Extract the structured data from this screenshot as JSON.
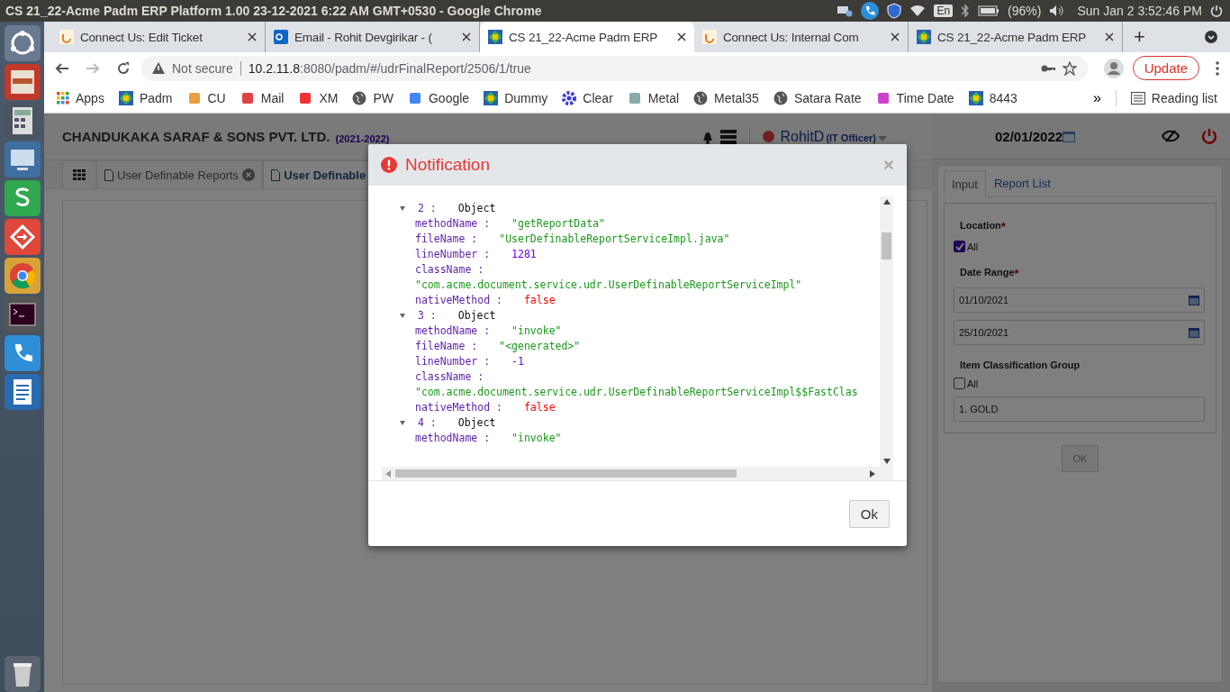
{
  "os_bar": {
    "title": "CS 21_22-Acme Padm ERP Platform 1.00 23-12-2021 6:22 AM GMT+0530 - Google Chrome",
    "keyboard": "En",
    "battery": "(96%)",
    "clock": "Sun Jan 2  3:52:46 PM"
  },
  "browser": {
    "tabs": [
      {
        "title": "Connect Us: Edit Ticket",
        "selected": false
      },
      {
        "title": "Email - Rohit Devgirikar - (",
        "selected": false
      },
      {
        "title": "CS 21_22-Acme Padm ERP",
        "selected": true
      },
      {
        "title": "Connect Us: Internal Com",
        "selected": false
      },
      {
        "title": "CS 21_22-Acme Padm ERP",
        "selected": false
      }
    ],
    "new_tab": "+",
    "security": "Not secure",
    "url_host": "10.2.11.8",
    "url_rest": ":8080/padm/#/udrFinalReport/2506/1/true",
    "update": "Update",
    "bookmarks": [
      "Apps",
      "Padm",
      "CU",
      "Mail",
      "XM",
      "PW",
      "Google",
      "Dummy",
      "Clear",
      "Metal",
      "Metal35",
      "Satara Rate",
      "Time Date",
      "8443"
    ],
    "more": "»",
    "reading_list": "Reading list"
  },
  "app": {
    "company": "CHANDUKAKA SARAF & SONS PVT. LTD.",
    "year": "(2021-2022)",
    "user": "RohitD",
    "role": "(IT Officer)",
    "tabs": [
      {
        "label": "User Definable Reports",
        "selected": false,
        "closable": true
      },
      {
        "label": "User Definable",
        "selected": true,
        "closable": false
      }
    ],
    "panel": {
      "date": "02/01/2022",
      "tabs": [
        {
          "label": "Input",
          "selected": true
        },
        {
          "label": "Report List",
          "selected": false
        }
      ],
      "location_label": {
        "text": "Location",
        "mark": "*"
      },
      "location_all": {
        "label": "All",
        "checked": true
      },
      "date_range_label": {
        "text": "Date Range",
        "mark": "*"
      },
      "from": "01/10/2021",
      "to": "25/10/2021",
      "group_label": {
        "text": "Item Classification Group"
      },
      "group_all": {
        "label": "All",
        "checked": false
      },
      "group_value": "1. GOLD",
      "ok": "OK"
    }
  },
  "dialog": {
    "title": "Notification",
    "close": "×",
    "ok": "Ok",
    "lines": [
      {
        "kind": "object",
        "index": "2 :",
        "label": "Object"
      },
      {
        "kind": "field",
        "key": "methodName :",
        "value": "\"getReportData\"",
        "color": "#1a9a1a",
        "wrapped": false
      },
      {
        "kind": "field",
        "key": "fileName :",
        "value": "\"UserDefinableReportServiceImpl.java\"",
        "color": "#1a9a1a",
        "wrapped": false
      },
      {
        "kind": "field",
        "key": "lineNumber :",
        "value": "1281",
        "color": "#6a00ff",
        "wrapped": false
      },
      {
        "kind": "field",
        "key": "className :",
        "value": "\"com.acme.document.service.udr.UserDefinableReportServiceImpl\"",
        "color": "#1a9a1a",
        "wrapped": true
      },
      {
        "kind": "field",
        "key": "nativeMethod :",
        "value": "false",
        "color": "#ff0000",
        "wrapped": false
      },
      {
        "kind": "object",
        "index": "3 :",
        "label": "Object"
      },
      {
        "kind": "field",
        "key": "methodName :",
        "value": "\"invoke\"",
        "color": "#1a9a1a",
        "wrapped": false
      },
      {
        "kind": "field",
        "key": "fileName :",
        "value": "\"<generated>\"",
        "color": "#1a9a1a",
        "wrapped": false
      },
      {
        "kind": "field",
        "key": "lineNumber :",
        "value": "-1",
        "color": "#6a00ff",
        "wrapped": false
      },
      {
        "kind": "field",
        "key": "className :",
        "value": "\"com.acme.document.service.udr.UserDefinableReportServiceImpl$$FastClas",
        "color": "#1a9a1a",
        "wrapped": true
      },
      {
        "kind": "field",
        "key": "nativeMethod :",
        "value": "false",
        "color": "#ff0000",
        "wrapped": false
      },
      {
        "kind": "object",
        "index": "4 :",
        "label": "Object"
      },
      {
        "kind": "field",
        "key": "methodName :",
        "value": "\"invoke\"",
        "color": "#1a9a1a",
        "wrapped": false
      }
    ]
  }
}
